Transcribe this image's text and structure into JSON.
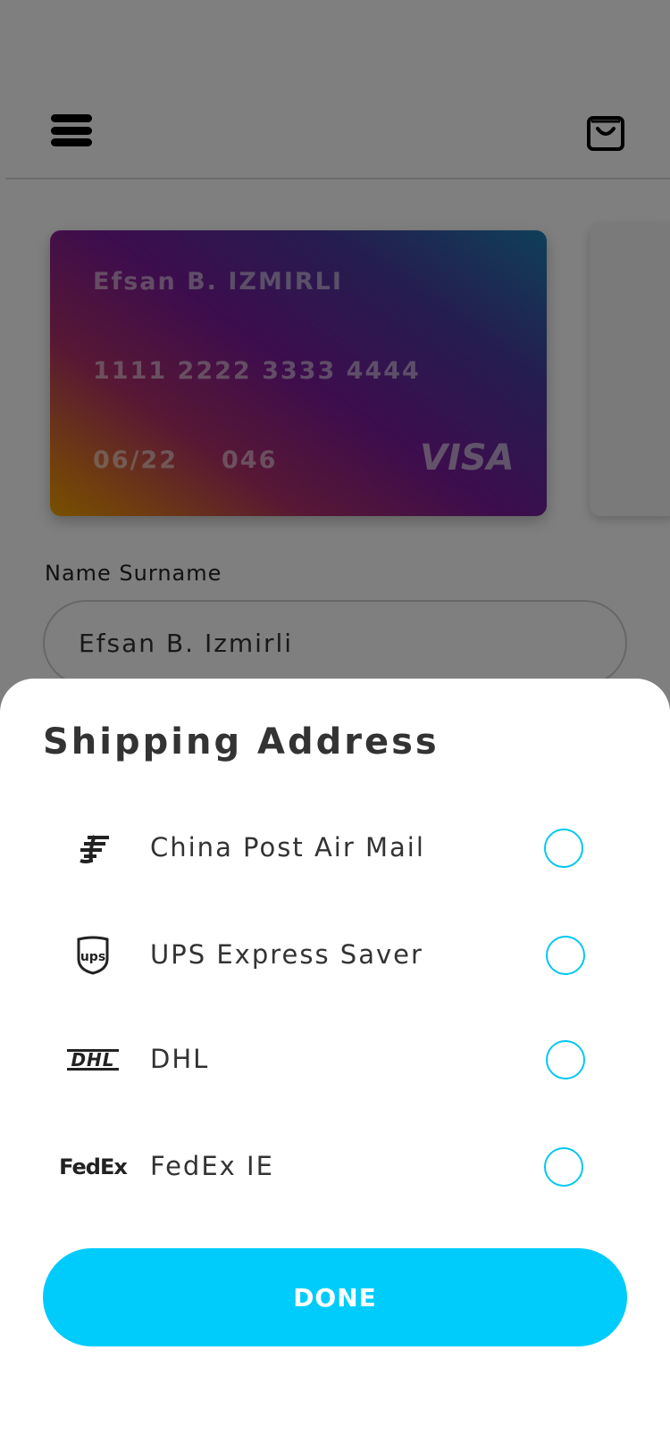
{
  "header": {
    "menu_icon": "hamburger-menu-icon",
    "cart_icon": "shopping-bag-icon"
  },
  "card": {
    "holder": "Efsan B. IZMIRLI",
    "number": "1111 2222 3333 4444",
    "expiry": "06/22",
    "cvv": "046",
    "brand": "VISA"
  },
  "form": {
    "name_label": "Name Surname",
    "name_value": "Efsan B. Izmirli"
  },
  "sheet": {
    "title": "Shipping Address",
    "options": [
      {
        "label": "China Post Air Mail",
        "icon": "china-post-logo-icon"
      },
      {
        "label": "UPS Express Saver",
        "icon": "ups-logo-icon",
        "logo_text": "ups"
      },
      {
        "label": "DHL",
        "icon": "dhl-logo-icon",
        "logo_text": "DHL"
      },
      {
        "label": "FedEx IE",
        "icon": "fedex-logo-icon",
        "logo_text": "FedEx"
      }
    ],
    "done_label": "DONE"
  },
  "colors": {
    "accent": "#00ccfc",
    "radio_border": "#00c8f0",
    "overlay": "rgba(0,0,0,0.5)"
  }
}
